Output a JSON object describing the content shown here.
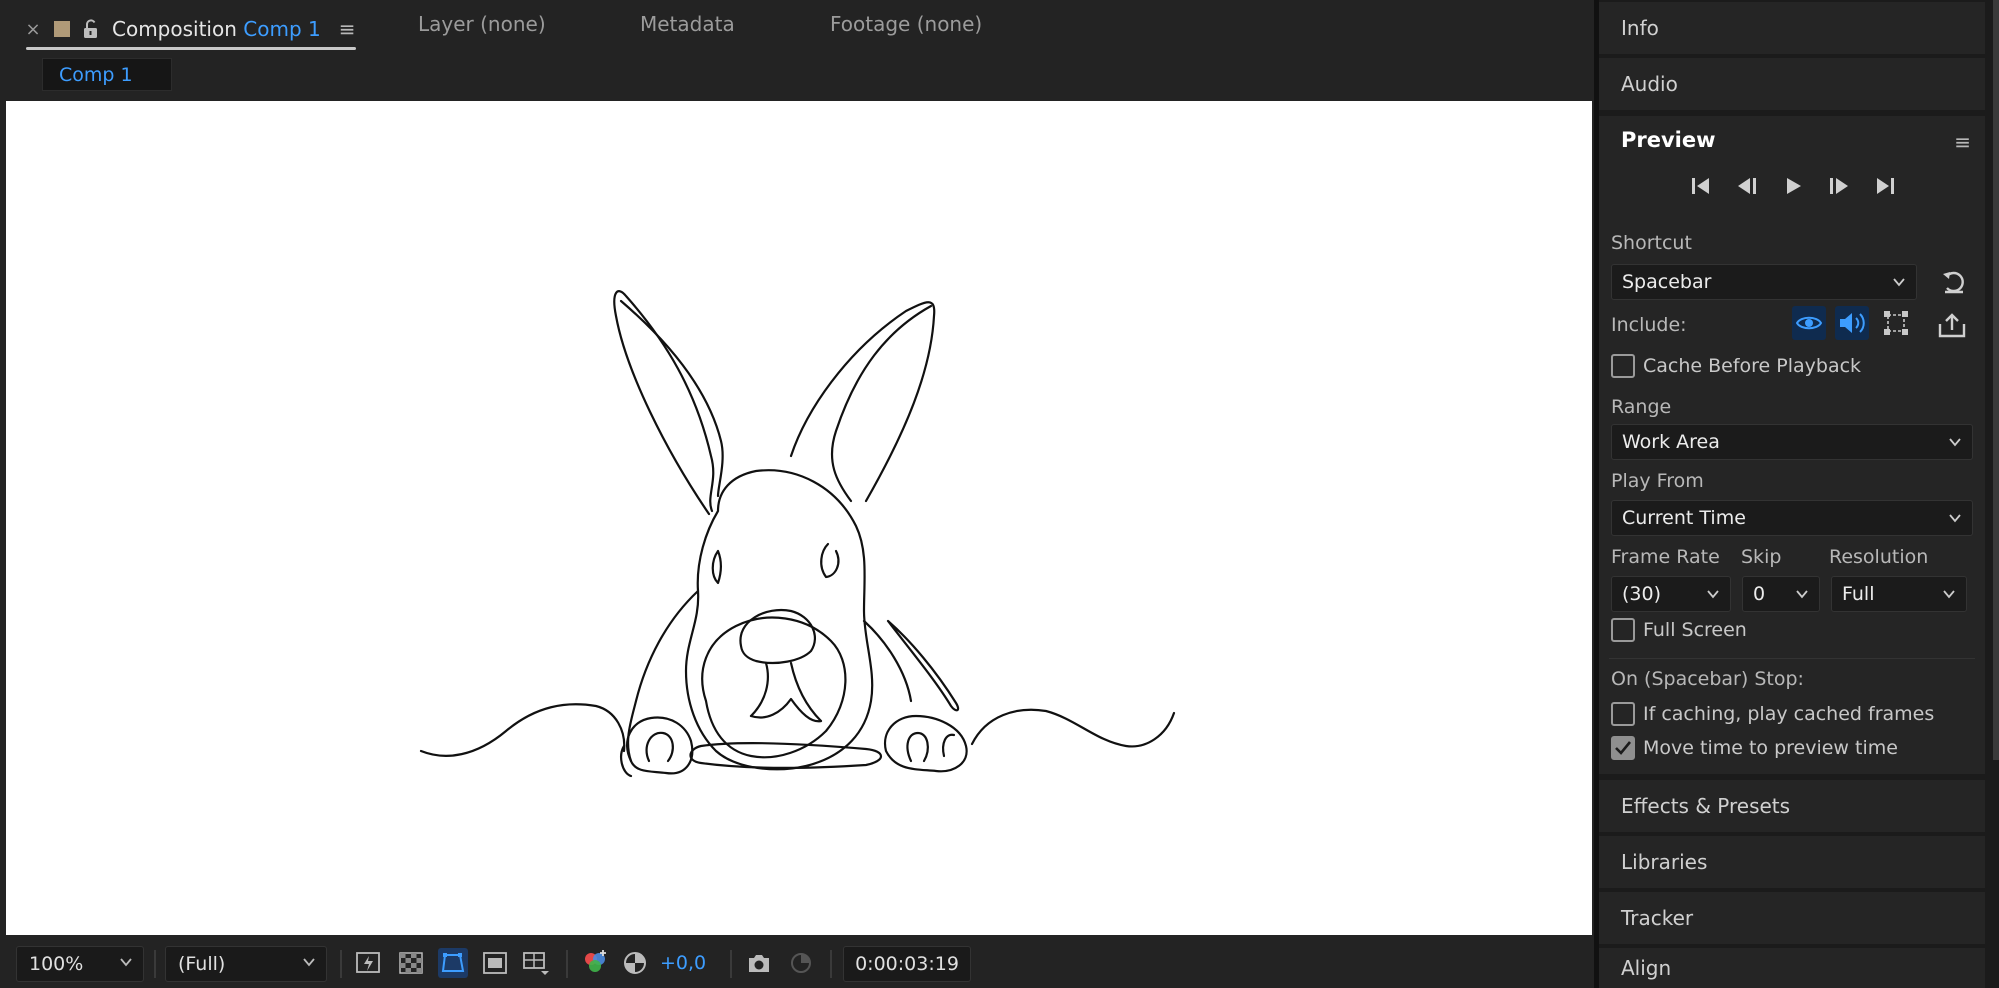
{
  "composition_panel": {
    "active_tab": {
      "prefix": "Composition",
      "comp_name": "Comp 1",
      "close_label": "×",
      "menu_label": "≡"
    },
    "other_tabs": [
      "Layer (none)",
      "Metadata",
      "Footage (none)"
    ],
    "subtab": "Comp 1",
    "footer": {
      "zoom": "100%",
      "resolution": "(Full)",
      "exposure": "+0,0",
      "timecode": "0:00:03:19"
    }
  },
  "right_panels": {
    "info": "Info",
    "audio": "Audio",
    "preview": {
      "title": "Preview",
      "menu_label": "≡",
      "shortcut_label": "Shortcut",
      "shortcut_value": "Spacebar",
      "include_label": "Include:",
      "cache_before_playback": "Cache Before Playback",
      "range_label": "Range",
      "range_value": "Work Area",
      "play_from_label": "Play From",
      "play_from_value": "Current Time",
      "frame_rate_label": "Frame Rate",
      "frame_rate_value": "(30)",
      "skip_label": "Skip",
      "skip_value": "0",
      "resolution_label": "Resolution",
      "resolution_value": "Full",
      "full_screen": "Full Screen",
      "on_stop_label": "On (Spacebar) Stop:",
      "if_caching": "If caching, play cached frames",
      "move_time": "Move time to preview time",
      "cache_checked": false,
      "full_screen_checked": false,
      "if_caching_checked": false,
      "move_time_checked": true
    },
    "effects_presets": "Effects & Presets",
    "libraries": "Libraries",
    "tracker": "Tracker",
    "align": "Align"
  },
  "colors": {
    "accent": "#3d9dff",
    "panel": "#252525",
    "background": "#1b1b1b"
  }
}
